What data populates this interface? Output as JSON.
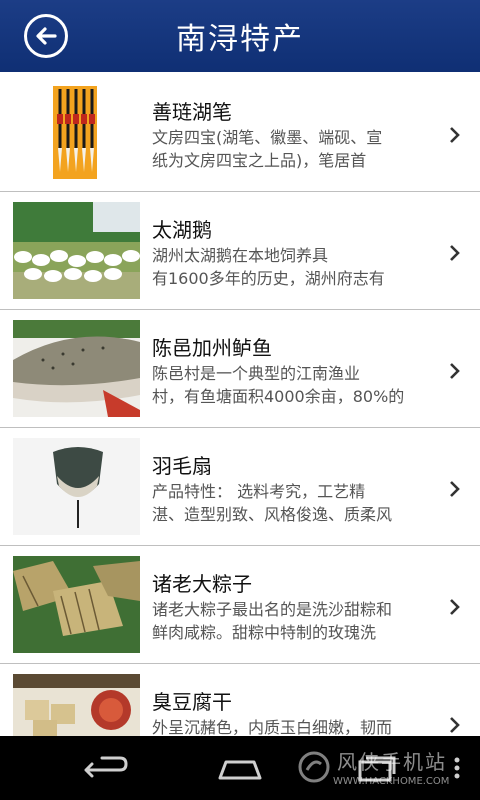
{
  "header": {
    "title": "南浔特产"
  },
  "items": [
    {
      "name": "善琏湖笔",
      "desc_line1": "文房四宝(湖笔、徽墨、端砚、宣",
      "desc_line2": "纸为文房四宝之上品)，笔居首"
    },
    {
      "name": "太湖鹅",
      "desc_line1": "湖州太湖鹅在本地饲养具",
      "desc_line2": "有1600多年的历史，湖州府志有"
    },
    {
      "name": "陈邑加州鲈鱼",
      "desc_line1": "陈邑村是一个典型的江南渔业",
      "desc_line2": "村，有鱼塘面积4000余亩，80%的"
    },
    {
      "name": "羽毛扇",
      "desc_line1": "产品特性： 选料考究，工艺精",
      "desc_line2": "湛、造型别致、风格俊逸、质柔风"
    },
    {
      "name": "诸老大粽子",
      "desc_line1": "诸老大粽子最出名的是洗沙甜粽和",
      "desc_line2": "鲜肉咸粽。甜粽中特制的玫瑰洗"
    },
    {
      "name": "臭豆腐干",
      "desc_line1": "外呈沉赭色，内质玉白细嫩，韧而",
      "desc_line2": ""
    }
  ],
  "watermark": {
    "text": "风侠手机站",
    "url": "WWW.HACKHOME.COM"
  },
  "colors": {
    "header": "#14357c",
    "navbar": "#000000"
  }
}
